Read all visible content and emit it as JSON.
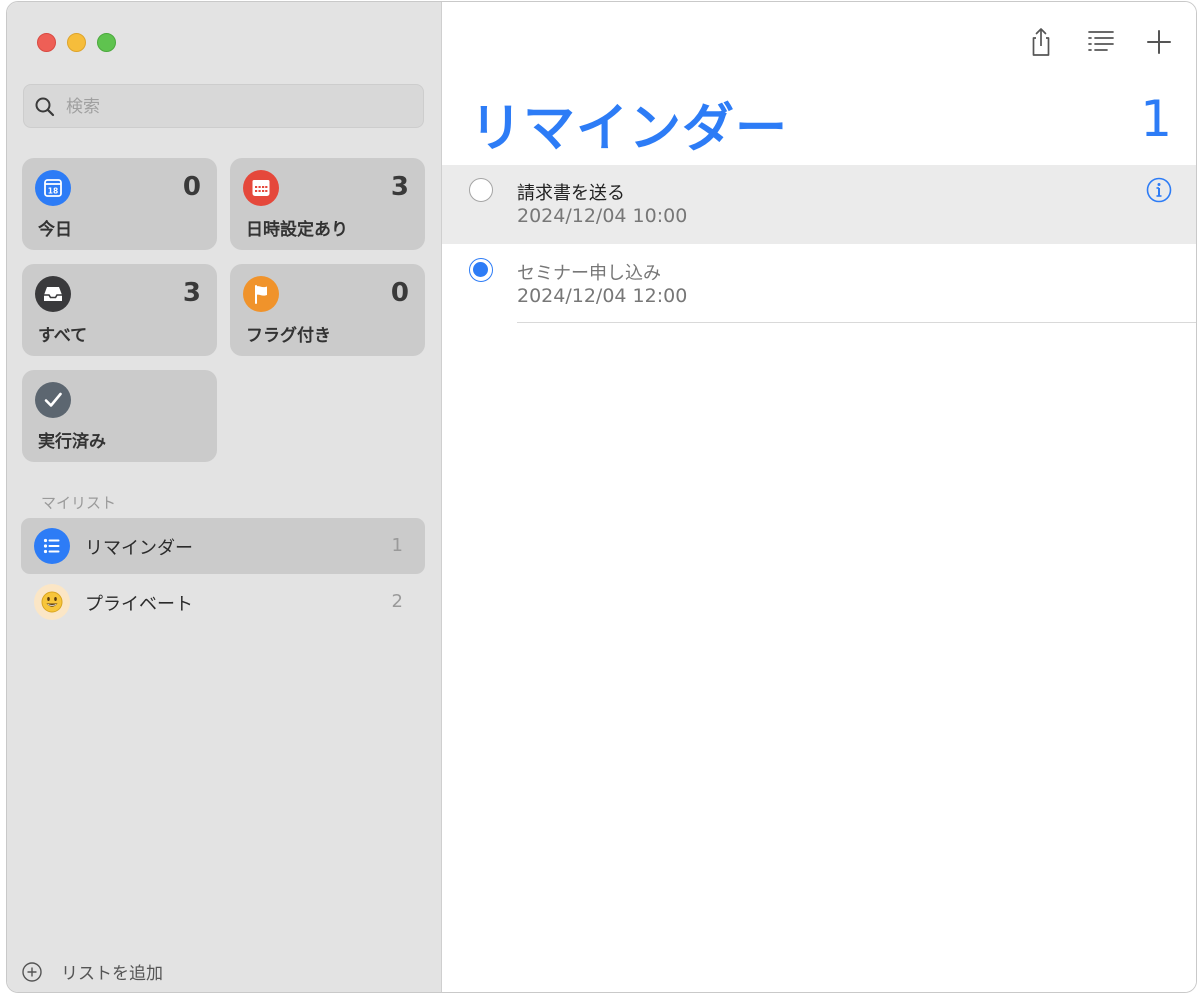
{
  "window": {
    "controls": [
      "close",
      "minimize",
      "maximize"
    ]
  },
  "search": {
    "placeholder": "検索",
    "value": ""
  },
  "smart_lists": [
    {
      "id": "today",
      "label": "今日",
      "count": "0",
      "icon": "calendar-icon",
      "icon_text": "18",
      "color": "#2d7cf6"
    },
    {
      "id": "scheduled",
      "label": "日時設定あり",
      "count": "3",
      "icon": "calendar-grid-icon",
      "color": "#e5483b"
    },
    {
      "id": "all",
      "label": "すべて",
      "count": "3",
      "icon": "tray-icon",
      "color": "#3a3a3c"
    },
    {
      "id": "flagged",
      "label": "フラグ付き",
      "count": "0",
      "icon": "flag-icon",
      "color": "#f0932b"
    },
    {
      "id": "completed",
      "label": "実行済み",
      "count": "",
      "icon": "checkmark-icon",
      "color": "#5c6670"
    }
  ],
  "my_lists": {
    "section_label": "マイリスト",
    "items": [
      {
        "name": "リマインダー",
        "count": "1",
        "icon": "list-bullet-icon",
        "color": "#2d7cf6",
        "selected": true
      },
      {
        "name": "プライベート",
        "count": "2",
        "icon": "smiley-icon",
        "color": "#fbe6c6",
        "selected": false
      }
    ]
  },
  "add_list": {
    "label": "リストを追加"
  },
  "toolbar": {
    "buttons": [
      "share-icon",
      "list-options-icon",
      "plus-icon"
    ]
  },
  "main": {
    "title": "リマインダー",
    "count": "1",
    "reminders": [
      {
        "title": "請求書を送る",
        "date": "2024/12/04 10:00",
        "completed": false,
        "highlighted": true
      },
      {
        "title": "セミナー申し込み",
        "date": "2024/12/04 12:00",
        "completed": true,
        "highlighted": false
      }
    ]
  },
  "colors": {
    "accent": "#2d7cf6",
    "sidebar_bg": "#e3e3e3",
    "card_bg": "#cbcbcb"
  }
}
